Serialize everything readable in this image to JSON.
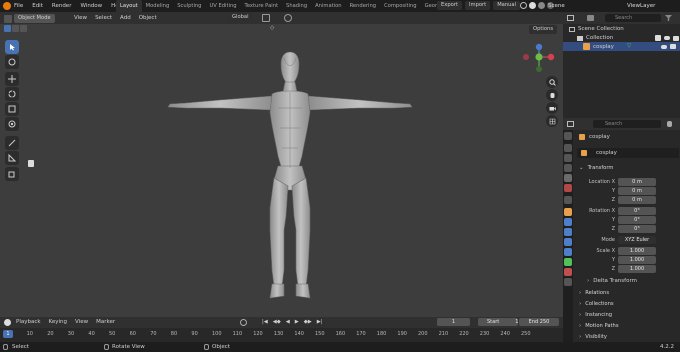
{
  "menu": [
    "File",
    "Edit",
    "Render",
    "Window",
    "Help"
  ],
  "workspaces": [
    "Layout",
    "Modeling",
    "Sculpting",
    "UV Editing",
    "Texture Paint",
    "Shading",
    "Animation",
    "Rendering",
    "Compositing",
    "Geometry N"
  ],
  "active_workspace": "Layout",
  "topright": {
    "export": "Export",
    "import": "Import",
    "manual": "Manual",
    "scene": "Scene",
    "viewlayer": "ViewLayer"
  },
  "viewport": {
    "mode": "Object Mode",
    "menus": [
      "View",
      "Select",
      "Add",
      "Object"
    ],
    "transform": "Global",
    "options": "Options"
  },
  "timeline": {
    "menus": [
      "Playback",
      "Keying",
      "View",
      "Marker"
    ],
    "current": "1",
    "start_label": "Start",
    "start": "1",
    "end_label": "End",
    "end": "250",
    "ruler": [
      "0",
      "10",
      "20",
      "30",
      "40",
      "50",
      "60",
      "70",
      "80",
      "90",
      "100",
      "110",
      "120",
      "130",
      "140",
      "150",
      "160",
      "170",
      "180",
      "190",
      "200",
      "210",
      "220",
      "230",
      "240",
      "250"
    ],
    "cursor": "1"
  },
  "status": {
    "select": "Select",
    "rotate": "Rotate View",
    "object": "Object",
    "version": "4.2.2"
  },
  "outliner": {
    "search_placeholder": "Search",
    "scene_collection": "Scene Collection",
    "collection": "Collection",
    "object": "cosplay"
  },
  "properties": {
    "search_placeholder": "Search",
    "object_name": "cosplay",
    "data_name": "cosplay",
    "transform": "Transform",
    "location_x_label": "Location X",
    "y_label": "Y",
    "z_label": "Z",
    "location": [
      "0 m",
      "0 m",
      "0 m"
    ],
    "rotation_x_label": "Rotation X",
    "rotation": [
      "0°",
      "0°",
      "0°"
    ],
    "mode_label": "Mode",
    "mode": "XYZ Euler",
    "scale_x_label": "Scale X",
    "scale": [
      "1.000",
      "1.000",
      "1.000"
    ],
    "delta": "Delta Transform",
    "sections": [
      "Relations",
      "Collections",
      "Instancing",
      "Motion Paths",
      "Visibility"
    ]
  }
}
